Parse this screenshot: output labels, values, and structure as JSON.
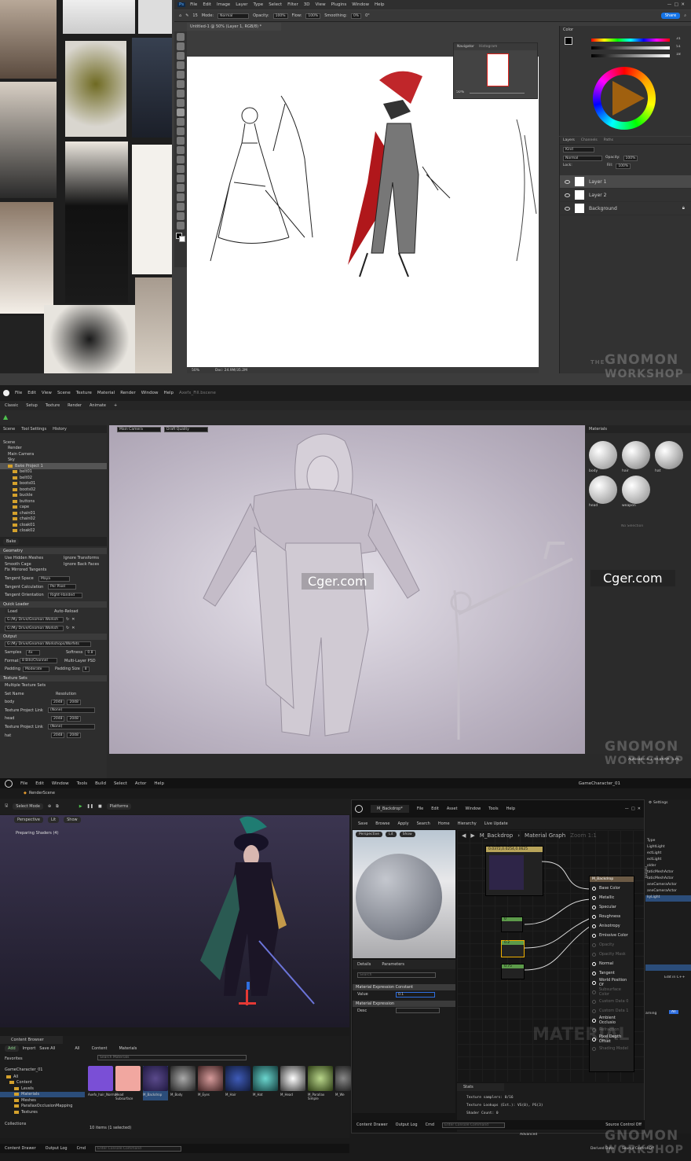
{
  "photoshop": {
    "menu": [
      "File",
      "Edit",
      "Image",
      "Layer",
      "Type",
      "Select",
      "Filter",
      "3D",
      "View",
      "Plugins",
      "Window",
      "Help"
    ],
    "options": {
      "mode_label": "Mode:",
      "mode": "Normal",
      "opacity_label": "Opacity:",
      "opacity": "100%",
      "flow_label": "Flow:",
      "flow": "100%",
      "smoothing_label": "Smoothing:",
      "smoothing": "0%",
      "angle": "0°",
      "brush_size": "15"
    },
    "share_label": "Share",
    "doc_tab": "Untitled-1 @ 50% (Layer 1, RGB/8) *",
    "status": {
      "zoom": "50%",
      "doc": "Doc: 24.9M/35.2M"
    },
    "navigator": {
      "tabs": [
        "Navigator",
        "Histogram"
      ],
      "zoom": "50%"
    },
    "color_panel": {
      "title": "Color",
      "values": [
        "31",
        "51",
        "18"
      ]
    },
    "layers_panel": {
      "tabs": [
        "Layers",
        "Channels",
        "Paths"
      ],
      "kind": "Kind",
      "blend": "Normal",
      "opacity_label": "Opacity:",
      "opacity": "100%",
      "lock_label": "Lock:",
      "fill_label": "Fill:",
      "fill": "100%",
      "layers": [
        "Layer 1",
        "Layer 2",
        "Background"
      ]
    },
    "watermark": {
      "top": "GNOMON",
      "bottom": "WORKSHOP",
      "side": "THE"
    }
  },
  "painter": {
    "menu": [
      "File",
      "Edit",
      "View",
      "Scene",
      "Texture",
      "Material",
      "Render",
      "Window",
      "Help"
    ],
    "title": "Axefx_Fill.bscene",
    "modes": [
      "Classic",
      "Setup",
      "Texture",
      "Render",
      "Animate",
      "+"
    ],
    "scene_tabs": [
      "Scene",
      "Tool Settings",
      "History"
    ],
    "tree": [
      "Scene",
      "Render",
      "Main Camera",
      "Sky",
      "Bake Project 1",
      "belt01",
      "belt02",
      "boots01",
      "boots02",
      "buckle",
      "buttons",
      "cape",
      "chain01",
      "chain02",
      "cloak01",
      "cloak02"
    ],
    "bake_label": "Bake",
    "geometry": {
      "title": "Geometry",
      "use_hidden": "Use Hidden Meshes",
      "ignore_transforms": "Ignore Transforms",
      "smooth_cage": "Smooth Cage",
      "ignore_back": "Ignore Back Faces",
      "fix_mirrored": "Fix Mirrored Tangents",
      "tangent_space_label": "Tangent Space",
      "tangent_space": "Maya",
      "tangent_calc_label": "Tangent Calculation",
      "tangent_calc": "Per Pixel",
      "tangent_orient_label": "Tangent Orientation",
      "tangent_orient": "Right-Handed"
    },
    "quick_loader": {
      "title": "Quick Loader",
      "load": "Load",
      "auto_reload": "Auto-Reload",
      "path1": "G:/My Drive/Gnomon Worksh",
      "path2": "G:/My Drive/Gnomon Worksh"
    },
    "output": {
      "title": "Output",
      "path": "G:/My Drive/Gnomon Workshops/Worfets",
      "samples_label": "Samples",
      "samples": "4x",
      "softness_label": "Softness",
      "softness": "0.8",
      "format_label": "Format",
      "format": "8 Bits/Channel",
      "multilayer": "Multi-Layer PSD",
      "padding_label": "Padding",
      "padding": "Moderate",
      "padding_size_label": "Padding Size",
      "padding_size": "8"
    },
    "texture_sets": {
      "title": "Texture Sets",
      "multiple": "Multiple Texture Sets",
      "set_name": "Set Name",
      "resolution": "Resolution",
      "project_link_label": "Texture Project Link",
      "project_link": "(None)",
      "rows": [
        {
          "name": "body",
          "w": "2048",
          "h": "2048"
        },
        {
          "name": "head",
          "w": "2048",
          "h": "2048"
        },
        {
          "name": "hat",
          "w": "2048",
          "h": "2048"
        }
      ]
    },
    "viewport": {
      "camera": "Main Camera",
      "quality": "Draft Quality",
      "status": "Autosave in 1:49  VRAM: 53%"
    },
    "materials": {
      "title": "Materials",
      "items": [
        "body",
        "hair",
        "hat",
        "head",
        "weapon"
      ],
      "no_selection": "No Selection"
    },
    "cger": "Cger.com"
  },
  "unreal": {
    "menu": [
      "File",
      "Edit",
      "Window",
      "Tools",
      "Build",
      "Select",
      "Actor",
      "Help"
    ],
    "project": "GameCharacter_01",
    "level_tab": "RenderScene",
    "select_mode": "Select Mode",
    "platforms": "Platforms",
    "viewport": {
      "perspective": "Perspective",
      "lit": "Lit",
      "show": "Show",
      "shaders": "Preparing Shaders (4)"
    },
    "settings": "Settings",
    "content_browser": {
      "tab": "Content Browser",
      "add": "Add",
      "import": "Import",
      "save_all": "Save All",
      "path": [
        "All",
        "Content",
        "Materials"
      ],
      "search": "Search Materials",
      "favorites": "Favorites",
      "root": "GameCharacter_01",
      "tree": [
        "All",
        "Content",
        "Levels",
        "Materials",
        "Meshes",
        "ParallaxOcclusionMapping",
        "Textures"
      ],
      "collections": "Collections",
      "count": "10 items (1 selected)",
      "assets": [
        {
          "name": "Axefx_hair_Normal",
          "color": "#7a4fd6"
        },
        {
          "name": "Head Subsurface",
          "color": "#f1a7a0"
        },
        {
          "name": "M_Backdrop",
          "color": "#3a2a6b"
        },
        {
          "name": "M_Body",
          "color": "#3a3a3a"
        },
        {
          "name": "M_Eyes",
          "color": "#6b2a2a"
        },
        {
          "name": "M_Hair",
          "color": "#1e2d5e"
        },
        {
          "name": "M_Hat",
          "color": "#2d5e5e"
        },
        {
          "name": "M_Head",
          "color": "#8a6a6a"
        },
        {
          "name": "M_Parallax Simple",
          "color": "#5e6b3a"
        },
        {
          "name": "M_We",
          "color": "#4a4a4a"
        }
      ]
    },
    "material_editor": {
      "tab": "M_Backdrop*",
      "menu": [
        "File",
        "Edit",
        "Asset",
        "Window",
        "Tools",
        "Help"
      ],
      "toolbar": [
        "Save",
        "Browse",
        "Apply",
        "Search",
        "Home",
        "Hierarchy",
        "Live Update"
      ],
      "graph_title": "M_Backdrop",
      "graph_crumb": "Material Graph",
      "zoom": "Zoom 1:1",
      "preview": {
        "perspective": "Perspective",
        "lit": "Lit",
        "show": "Show"
      },
      "details_tab": "Details",
      "params_tab": "Parameters",
      "search": "Search",
      "section1": "Material Expression Constant",
      "value_label": "Value",
      "value": "0.1",
      "section2": "Material Expression",
      "desc_label": "Desc",
      "color_node": "0.0372,0.0254,0.0625",
      "consts": [
        "0",
        "0.2",
        "0.75"
      ],
      "result_node": "M_Backdrop",
      "pins": [
        "Base Color",
        "Metallic",
        "Specular",
        "Roughness",
        "Anisotropy",
        "Emissive Color",
        "Opacity",
        "Opacity Mask",
        "Normal",
        "Tangent",
        "World Position Of",
        "Subsurface Color",
        "Custom Data 0",
        "Custom Data 1",
        "Ambient Occlusio",
        "Refraction",
        "Pixel Depth Offset",
        "Shading Model"
      ],
      "pin_active": [
        true,
        true,
        true,
        true,
        true,
        true,
        false,
        false,
        true,
        true,
        true,
        false,
        false,
        false,
        true,
        false,
        true,
        false
      ],
      "watermark": "MATERIAL",
      "stats_tab": "Stats",
      "stats": [
        "Texture samplers: 0/16",
        "Texture Lookups (Est.): VS(0), PS(3)",
        "Shader Count: 0"
      ],
      "bottom": [
        "Content Drawer",
        "Output Log",
        "Cmd"
      ],
      "console": "Enter Console Command",
      "source_control": "Source Control Off"
    },
    "outliner": [
      "Type",
      "LightLight",
      "ectLight",
      "ectLight",
      "older",
      "taticMeshActor",
      "taticMeshActor",
      "aneCameraActor",
      "aneCameraActor",
      "kyLight"
    ],
    "palette": "Palette",
    "edit_cpp": "Edit in C++",
    "warning": "arning",
    "all": "All",
    "advanced": "Advanced",
    "bottom": [
      "Content Drawer",
      "Output Log",
      "Cmd"
    ],
    "console": "Enter Console Command",
    "derived": "Derived Data",
    "source_control": "Source Control Off"
  }
}
